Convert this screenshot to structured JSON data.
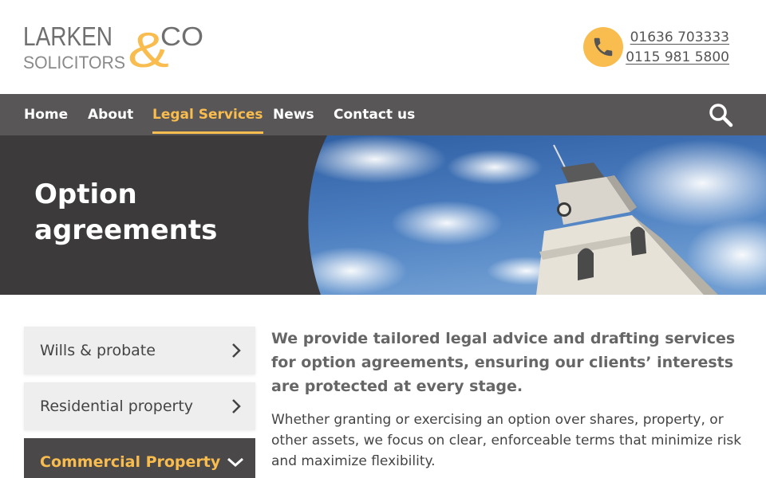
{
  "brand": {
    "name_line1": "LARKEN",
    "ampersand": "&",
    "name_co": "CO",
    "name_line2": "SOLICITORS",
    "accent_color": "#f9bc4e",
    "dark_color": "#3c3a3a",
    "nav_color": "#585656"
  },
  "contact": {
    "icon": "phone-icon",
    "phone_1": "01636 703333",
    "phone_2": "0115 981 5800"
  },
  "nav": {
    "items": [
      {
        "label": "Home",
        "active": false
      },
      {
        "label": "About",
        "active": false
      },
      {
        "label": "Legal Services",
        "active": true
      },
      {
        "label": "News",
        "active": false
      },
      {
        "label": "Contact us",
        "active": false
      }
    ],
    "search_icon": "search-icon"
  },
  "hero": {
    "title": "Option agreements",
    "image": "clock-tower-photo"
  },
  "sidebar": {
    "items": [
      {
        "label": "Wills & probate",
        "icon": "chevron-right-icon",
        "expanded": false
      },
      {
        "label": "Residential property",
        "icon": "chevron-right-icon",
        "expanded": false
      },
      {
        "label": "Commercial Property",
        "icon": "chevron-down-icon",
        "expanded": true
      }
    ]
  },
  "content": {
    "lead": "We provide tailored legal advice and drafting services for option agreements, ensuring our clients’ interests are protected at every stage.",
    "body": "Whether granting or exercising an option over shares, property, or other assets, we focus on clear, enforceable terms that minimize risk and maximize flexibility."
  }
}
